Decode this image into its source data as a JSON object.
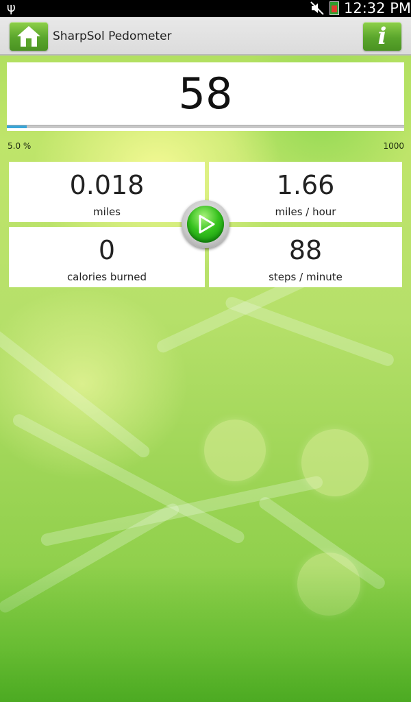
{
  "status_bar": {
    "time": "12:32 PM",
    "icons": [
      "usb-icon",
      "mute-icon",
      "battery-icon"
    ]
  },
  "app_bar": {
    "title": "SharpSol Pedometer",
    "home_icon": "home-icon",
    "info_label": "i"
  },
  "steps": {
    "count": "58",
    "progress_percent_label": "5.0 %",
    "goal_label": "1000",
    "progress_fraction": 0.05
  },
  "stats": {
    "distance": {
      "value": "0.018",
      "label": "miles"
    },
    "speed": {
      "value": "1.66",
      "label": "miles / hour"
    },
    "calories": {
      "value": "0",
      "label": "calories burned"
    },
    "cadence": {
      "value": "88",
      "label": "steps / minute"
    }
  },
  "play_button": {
    "icon": "play-icon"
  },
  "colors": {
    "accent_green": "#5aa52c",
    "progress_blue": "#3aa6d8",
    "status_bar": "#000000"
  }
}
